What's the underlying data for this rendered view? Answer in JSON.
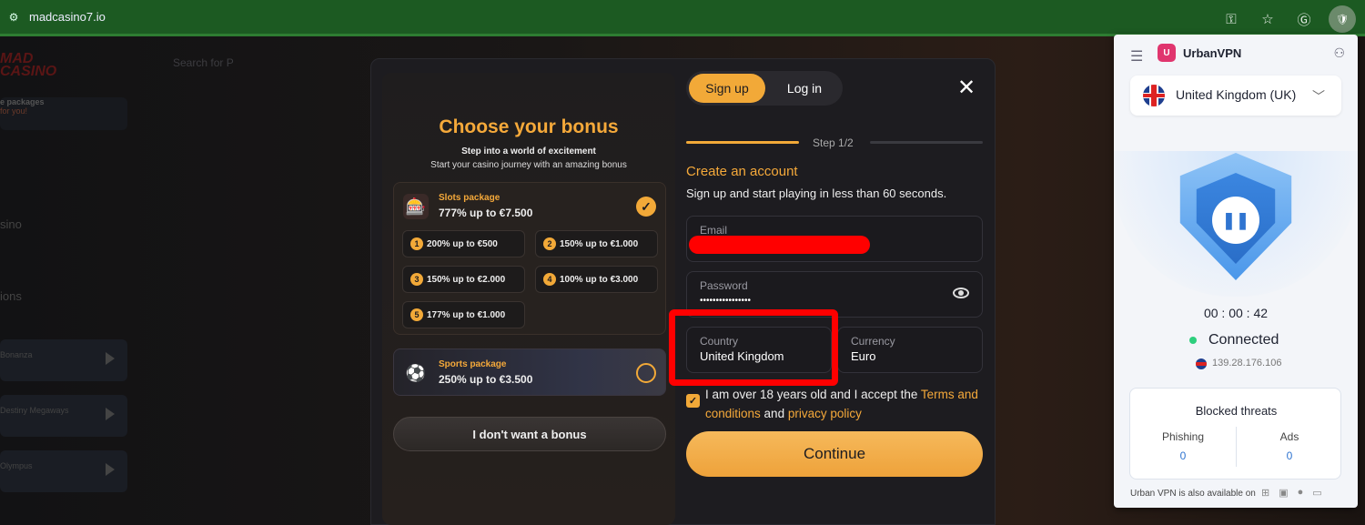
{
  "browser": {
    "url": "madcasino7.io"
  },
  "background": {
    "logo_line1": "MAD",
    "logo_line2": "CASINO",
    "search_placeholder": "Search for P",
    "promo_line1": "e packages",
    "promo_line2": "for you!",
    "side_item1": "sino",
    "side_item2": "ions",
    "card1": "Bonanza",
    "card2": "Destiny Megaways",
    "card3": "Olympus"
  },
  "bonus": {
    "title": "Choose your bonus",
    "subtitle1": "Step into a world of excitement",
    "subtitle2": "Start your casino journey with an amazing bonus",
    "slots": {
      "name": "Slots package",
      "value": "777% up to €7.500",
      "tiers": [
        {
          "num": "1",
          "label": "200% up to €500"
        },
        {
          "num": "2",
          "label": "150% up to €1.000"
        },
        {
          "num": "3",
          "label": "150% up to €2.000"
        },
        {
          "num": "4",
          "label": "100% up to €3.000"
        },
        {
          "num": "5",
          "label": "177% up to €1.000"
        }
      ]
    },
    "sports": {
      "name": "Sports package",
      "value": "250% up to €3.500"
    },
    "no_bonus_label": "I don't want a bonus"
  },
  "form": {
    "tab_signup": "Sign up",
    "tab_login": "Log in",
    "close_glyph": "✕",
    "step_label": "Step 1/2",
    "title": "Create an account",
    "subtitle": "Sign up and start playing in less than 60 seconds.",
    "email_label": "Email",
    "password_label": "Password",
    "password_value": "••••••••••••••••",
    "country_label": "Country",
    "country_value": "United Kingdom",
    "currency_label": "Currency",
    "currency_value": "Euro",
    "terms_prefix": "I am over 18 years old and I accept the ",
    "terms_link": "Terms and conditions",
    "terms_and": " and ",
    "privacy_link": "privacy policy",
    "continue_label": "Continue"
  },
  "vpn": {
    "brand": "UrbanVPN",
    "country": "United Kingdom (UK)",
    "timer": "00 : 00 : 42",
    "status": "Connected",
    "ip": "139.28.176.106",
    "blocked_title": "Blocked threats",
    "phishing_label": "Phishing",
    "phishing_value": "0",
    "ads_label": "Ads",
    "ads_value": "0",
    "available_text": "Urban VPN is also available on"
  },
  "colors": {
    "accent": "#f2a938",
    "browser_bar": "#1c5a22",
    "highlight": "#ff0000",
    "vpn_blue": "#2f74d0"
  }
}
